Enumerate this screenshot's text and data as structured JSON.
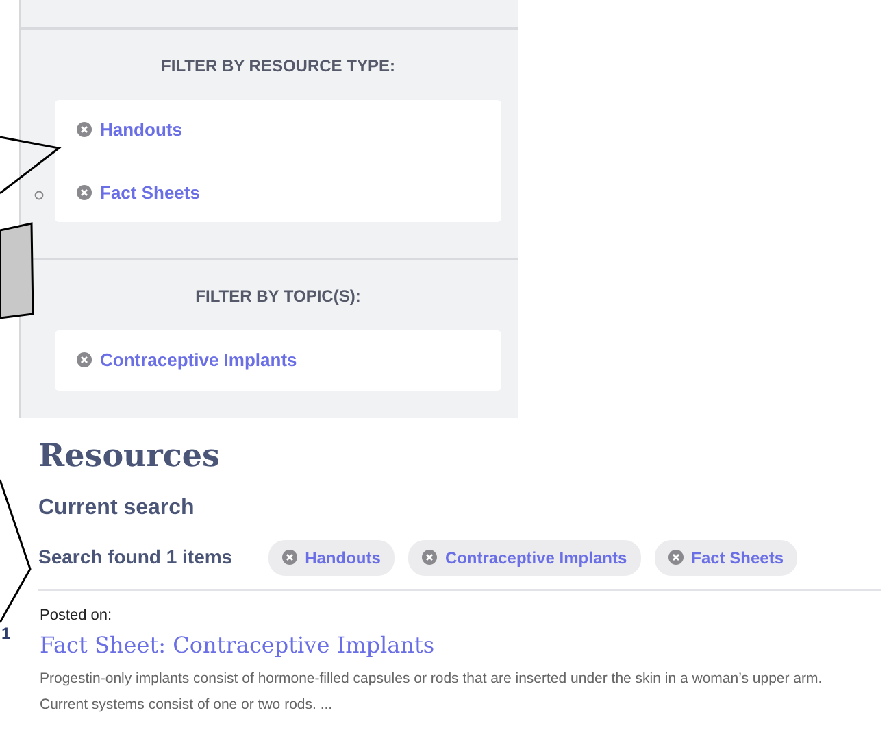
{
  "filter_sections": [
    {
      "heading": "FILTER BY RESOURCE TYPE:",
      "filters": [
        "Handouts",
        "Fact Sheets"
      ]
    },
    {
      "heading": "FILTER BY TOPIC(S):",
      "filters": [
        "Contraceptive Implants"
      ]
    }
  ],
  "page_title": "Resources",
  "current_search_heading": "Current search",
  "result_count": "Search found 1 items",
  "chips": [
    "Handouts",
    "Contraceptive Implants",
    "Fact Sheets"
  ],
  "results": [
    {
      "number": "1",
      "posted_label": "Posted on:",
      "title": "Fact Sheet: Contraceptive Implants",
      "summary": "Progestin-only implants consist of hormone-filled capsules or rods that are inserted under the skin in a woman’s upper arm. Current systems consist of one or two rods. ..."
    }
  ]
}
